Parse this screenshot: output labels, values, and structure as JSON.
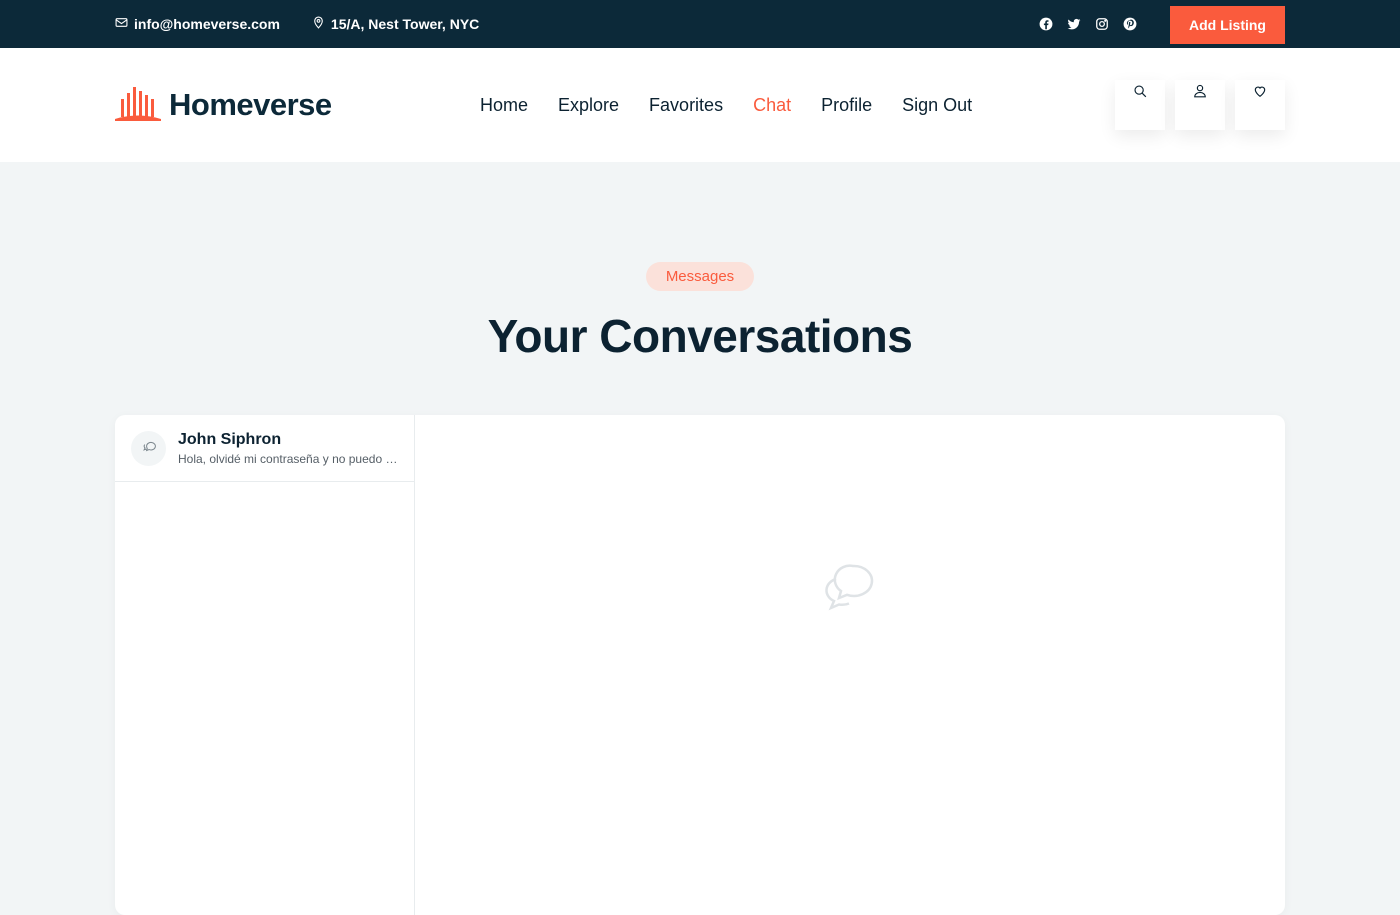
{
  "topbar": {
    "email": "info@homeverse.com",
    "address": "15/A, Nest Tower, NYC",
    "social_icons": [
      "facebook-icon",
      "twitter-icon",
      "instagram-icon",
      "pinterest-icon"
    ],
    "add_listing_label": "Add Listing"
  },
  "header": {
    "logo_text": "Homeverse",
    "nav": [
      {
        "label": "Home",
        "active": false
      },
      {
        "label": "Explore",
        "active": false
      },
      {
        "label": "Favorites",
        "active": false
      },
      {
        "label": "Chat",
        "active": true
      },
      {
        "label": "Profile",
        "active": false
      },
      {
        "label": "Sign Out",
        "active": false
      }
    ],
    "action_icons": [
      "search-icon",
      "user-icon",
      "heart-icon"
    ]
  },
  "section": {
    "badge": "Messages",
    "title": "Your Conversations"
  },
  "conversations": [
    {
      "name": "John Siphron",
      "preview": "Hola, olvidé mi contraseña y no puedo acceder a mi cuenta"
    }
  ],
  "colors": {
    "accent": "#fa5b3d",
    "dark": "#0c2939",
    "background": "#f2f5f6"
  }
}
